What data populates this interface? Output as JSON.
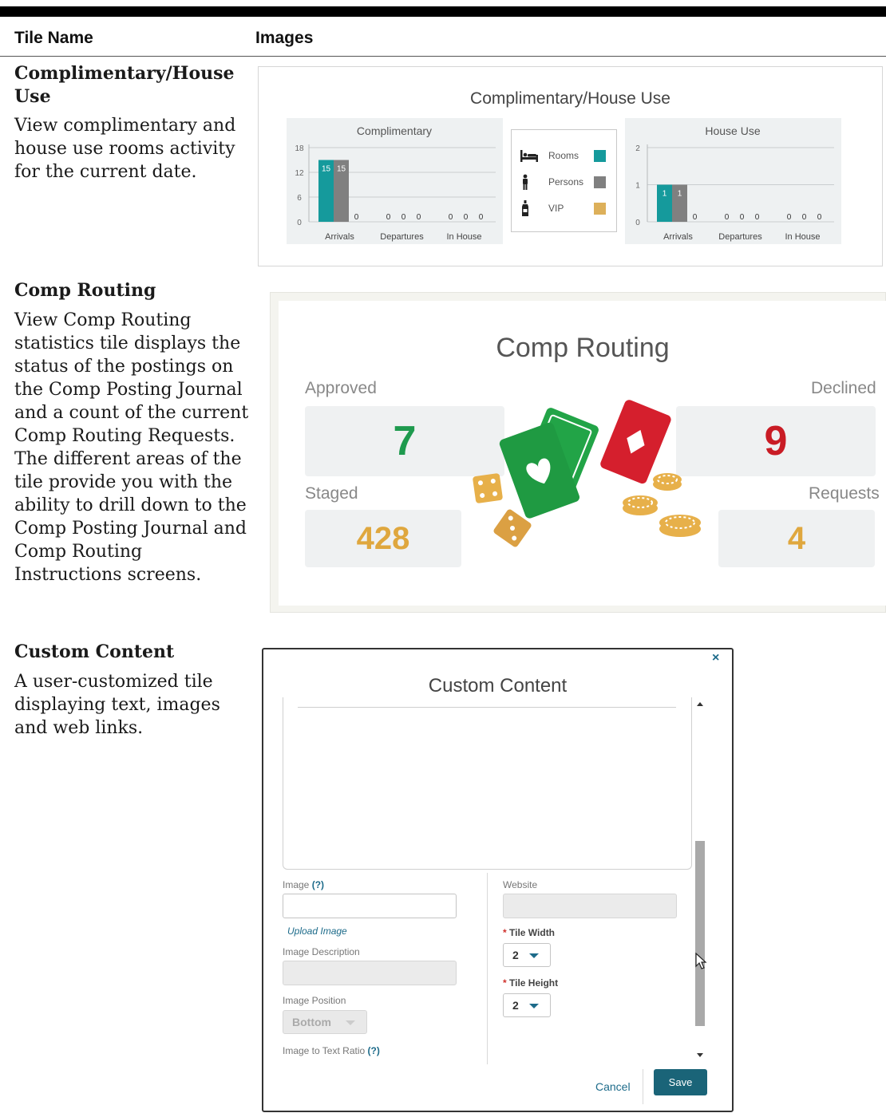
{
  "header": {
    "col1": "Tile Name",
    "col2": "Images"
  },
  "rows": [
    {
      "name": "Complimentary/House Use",
      "desc": "View complimentary and house use rooms activity for the current date."
    },
    {
      "name": "Comp Routing",
      "desc": "View Comp Routing statistics tile displays the status of the postings on the Comp Posting Journal and a count of the current Comp Routing Requests. The different areas of the tile provide you with the ability to drill down to the Comp Posting Journal and Comp Routing Instructions screens."
    },
    {
      "name": "Custom Content",
      "desc": "A user-customized tile displaying text, images and web links."
    }
  ],
  "tile_comp_house": {
    "title": "Complimentary/House Use",
    "legend": [
      {
        "label": "Rooms",
        "icon": "bed-icon",
        "color": "#159a9c"
      },
      {
        "label": "Persons",
        "icon": "person-icon",
        "color": "#808080"
      },
      {
        "label": "VIP",
        "icon": "vip-bottle-icon",
        "color": "#ddb05a"
      }
    ]
  },
  "chart_data": [
    {
      "type": "bar",
      "title": "Complimentary",
      "categories": [
        "Arrivals",
        "Departures",
        "In House"
      ],
      "series": [
        {
          "name": "Rooms",
          "values": [
            15,
            0,
            0
          ],
          "color": "#159a9c"
        },
        {
          "name": "Persons",
          "values": [
            15,
            0,
            0
          ],
          "color": "#808080"
        },
        {
          "name": "VIP",
          "values": [
            0,
            0,
            0
          ],
          "color": "#ddb05a"
        }
      ],
      "yticks": [
        0,
        6,
        12,
        18
      ],
      "ylim": [
        0,
        18
      ],
      "grid": true,
      "legend": "center"
    },
    {
      "type": "bar",
      "title": "House Use",
      "categories": [
        "Arrivals",
        "Departures",
        "In House"
      ],
      "series": [
        {
          "name": "Rooms",
          "values": [
            1,
            0,
            0
          ],
          "color": "#159a9c"
        },
        {
          "name": "Persons",
          "values": [
            1,
            0,
            0
          ],
          "color": "#808080"
        },
        {
          "name": "VIP",
          "values": [
            0,
            0,
            0
          ],
          "color": "#ddb05a"
        }
      ],
      "yticks": [
        0,
        1,
        2
      ],
      "ylim": [
        0,
        2
      ],
      "grid": true,
      "legend": "center"
    }
  ],
  "tile_comp_routing": {
    "title": "Comp Routing",
    "approved_label": "Approved",
    "approved_value": "7",
    "approved_color": "#1e9a4e",
    "declined_label": "Declined",
    "declined_value": "9",
    "declined_color": "#c91c25",
    "staged_label": "Staged",
    "staged_value": "428",
    "staged_color": "#dfa73e",
    "requests_label": "Requests",
    "requests_value": "4",
    "requests_color": "#dfa73e"
  },
  "tile_custom_content": {
    "title": "Custom Content",
    "close": "×",
    "image_label": "Image",
    "image_help": "(?)",
    "upload_link": "Upload Image",
    "image_desc_label": "Image Description",
    "image_position_label": "Image Position",
    "image_position_value": "Bottom",
    "image_ratio_label": "Image to Text Ratio",
    "image_ratio_help": "(?)",
    "website_label": "Website",
    "tile_width_label": "Tile Width",
    "tile_width_value": "2",
    "tile_height_label": "Tile Height",
    "tile_height_value": "2",
    "cancel": "Cancel",
    "save": "Save",
    "required_mark": "*"
  }
}
